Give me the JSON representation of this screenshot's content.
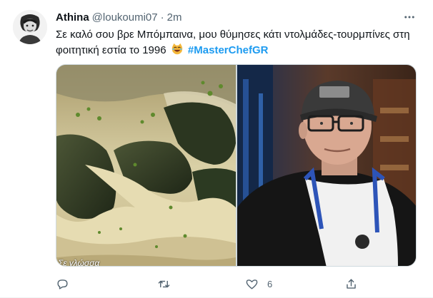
{
  "tweet": {
    "author_name": "Athina",
    "handle": "@loukoumi07",
    "separator": "·",
    "time": "2m",
    "text_main": "Σε καλό σου βρε Μπόμπαινα, μου θύμησες κάτι ντολμάδες-τουρμπίνες στη φοιτητική εστία το 1996",
    "hashtag": "#MasterChefGR",
    "photo_caption": "Σε γλώσσα",
    "actions": {
      "reply_icon": "reply-icon",
      "retweet_icon": "retweet-icon",
      "like_icon": "heart-icon",
      "like_count": "6",
      "share_icon": "share-icon"
    }
  },
  "colors": {
    "link": "#1d9bf0",
    "secondary_text": "#536471",
    "primary_text": "#0f1419"
  }
}
